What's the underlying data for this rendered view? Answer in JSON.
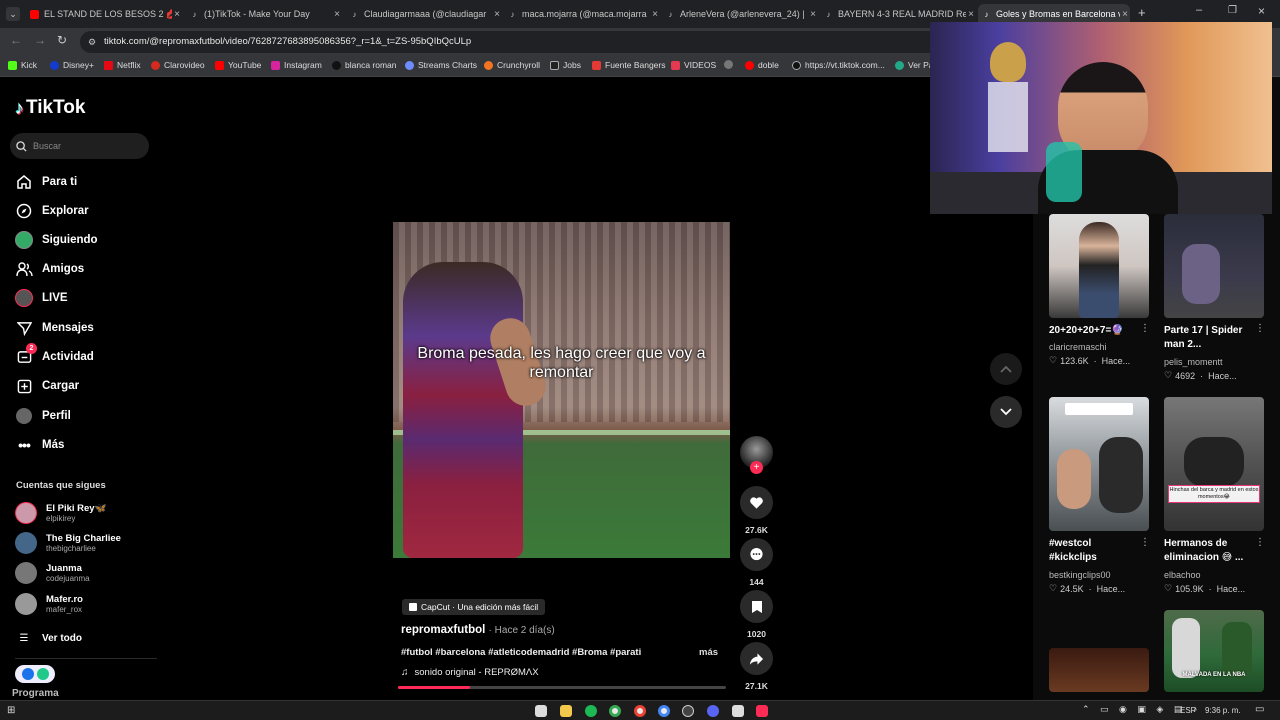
{
  "browser": {
    "tabs": [
      {
        "title": "EL STAND DE LOS BESOS 2 💋💋",
        "color": "#ff0000"
      },
      {
        "title": "(1)TikTok - Make Your Day",
        "color": "#000"
      },
      {
        "title": "Claudiagarmaaa (@claudiagar",
        "color": "#000"
      },
      {
        "title": "maca.mojarra (@maca.mojarra",
        "color": "#000"
      },
      {
        "title": "ArleneVera (@arlenevera_24) |",
        "color": "#000"
      },
      {
        "title": "BAYERN 4-3 REAL MADRID Re",
        "color": "#000"
      },
      {
        "title": "Goles y Bromas en Barcelona v",
        "color": "#000"
      }
    ],
    "url": "tiktok.com/@repromaxfutbol/video/7628727683895086356?_r=1&_t=ZS-95bQIbQcULp",
    "bookmarks": [
      "Kick",
      "Disney+",
      "Netflix",
      "Clarovideo",
      "YouTube",
      "Instagram",
      "blanca roman",
      "Streams Charts",
      "Crunchyroll",
      "Jobs",
      "Fuente Bangers",
      "VIDEOS",
      "",
      "doble",
      "https://vt.tiktok.com...",
      "Ver Pa"
    ]
  },
  "sidebar": {
    "logo": "TikTok",
    "search_placeholder": "Buscar",
    "nav": [
      "Para ti",
      "Explorar",
      "Siguiendo",
      "Amigos",
      "LIVE",
      "Mensajes",
      "Actividad",
      "Cargar",
      "Perfil",
      "Más"
    ],
    "activity_badge": "2",
    "following_title": "Cuentas que sigues",
    "accounts": [
      {
        "name": "El Piki Rey🦋",
        "handle": "elpikirey"
      },
      {
        "name": "The Big Charliee",
        "handle": "thebigcharliee"
      },
      {
        "name": "Juanma",
        "handle": "codejuanma"
      },
      {
        "name": "Mafer.ro",
        "handle": "mafer_rox"
      }
    ],
    "see_all": "Ver todo",
    "program": "Programa"
  },
  "video": {
    "caption": "Broma pesada, les hago creer que voy a remontar",
    "capcut": "CapCut · Una edición más fácil",
    "author": "repromaxfutbol",
    "date": "· Hace 2 día(s)",
    "hashtags": "#futbol #barcelona #atleticodemadrid #Broma #parati",
    "more": "más",
    "sound": "sonido original - REPRØMΛX",
    "progress": 0.22
  },
  "actions": {
    "likes": "27.6K",
    "comments": "144",
    "saves": "1020",
    "shares": "27.1K"
  },
  "recommended": [
    {
      "title": "20+20+20+7=🔮",
      "user": "claricremaschi",
      "likes": "123.6K",
      "time": "Hace..."
    },
    {
      "title": "Parte 17 | Spider man 2...",
      "user": "pelis_momentt",
      "likes": "4692",
      "time": "Hace..."
    },
    {
      "title": "#westcol #kickclips",
      "user": "bestkingclips00",
      "likes": "24.5K",
      "time": "Hace..."
    },
    {
      "title": "Hermanos de eliminacion 😅 ...",
      "user": "elbachoo",
      "likes": "105.9K",
      "time": "Hace..."
    }
  ],
  "thumb_texts": {
    "hermanos": "Hinchas del barca y madrid en estos momentos😂",
    "nba": "MALVADA EN LA NBA"
  },
  "taskbar": {
    "lang": "ESP",
    "time": "9:36 p. m."
  }
}
